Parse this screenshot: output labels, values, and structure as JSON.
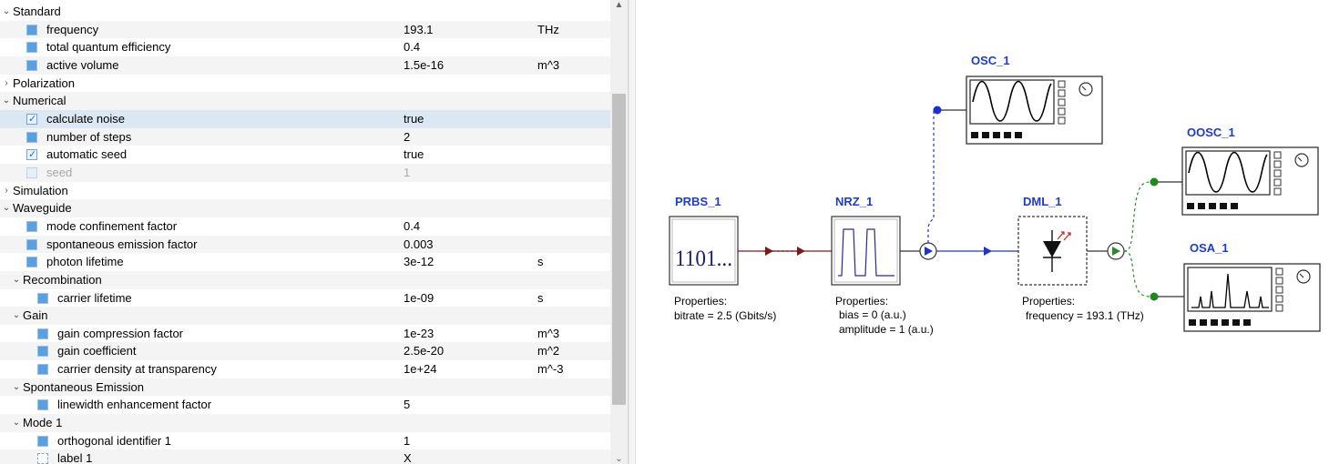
{
  "properties": {
    "rows": [
      {
        "kind": "group",
        "indent": 0,
        "expanded": true,
        "name": "Standard"
      },
      {
        "kind": "prop",
        "indent": 1,
        "check": "blue",
        "name": "frequency",
        "value": "193.1",
        "unit": "THz"
      },
      {
        "kind": "prop",
        "indent": 1,
        "check": "blue",
        "name": "total quantum efficiency",
        "value": "0.4",
        "unit": ""
      },
      {
        "kind": "prop",
        "indent": 1,
        "check": "blue",
        "name": "active volume",
        "value": "1.5e-16",
        "unit": "m^3"
      },
      {
        "kind": "group",
        "indent": 0,
        "expanded": false,
        "name": "Polarization"
      },
      {
        "kind": "group",
        "indent": 0,
        "expanded": true,
        "name": "Numerical"
      },
      {
        "kind": "prop",
        "indent": 1,
        "check": "on",
        "name": "calculate noise",
        "value": "true",
        "unit": "",
        "selected": true
      },
      {
        "kind": "prop",
        "indent": 1,
        "check": "blue",
        "name": "number of steps",
        "value": "2",
        "unit": ""
      },
      {
        "kind": "prop",
        "indent": 1,
        "check": "on",
        "name": "automatic seed",
        "value": "true",
        "unit": ""
      },
      {
        "kind": "prop",
        "indent": 1,
        "check": "off",
        "name": "seed",
        "value": "1",
        "unit": "",
        "disabled": true
      },
      {
        "kind": "group",
        "indent": 0,
        "expanded": false,
        "name": "Simulation"
      },
      {
        "kind": "group",
        "indent": 0,
        "expanded": true,
        "name": "Waveguide"
      },
      {
        "kind": "prop",
        "indent": 1,
        "check": "blue",
        "name": "mode confinement factor",
        "value": "0.4",
        "unit": ""
      },
      {
        "kind": "prop",
        "indent": 1,
        "check": "blue",
        "name": "spontaneous emission factor",
        "value": "0.003",
        "unit": ""
      },
      {
        "kind": "prop",
        "indent": 1,
        "check": "blue",
        "name": "photon lifetime",
        "value": "3e-12",
        "unit": "s"
      },
      {
        "kind": "group",
        "indent": 1,
        "expanded": true,
        "name": "Recombination"
      },
      {
        "kind": "prop",
        "indent": 2,
        "check": "blue",
        "name": "carrier lifetime",
        "value": "1e-09",
        "unit": "s"
      },
      {
        "kind": "group",
        "indent": 1,
        "expanded": true,
        "name": "Gain"
      },
      {
        "kind": "prop",
        "indent": 2,
        "check": "blue",
        "name": "gain compression factor",
        "value": "1e-23",
        "unit": "m^3"
      },
      {
        "kind": "prop",
        "indent": 2,
        "check": "blue",
        "name": "gain coefficient",
        "value": "2.5e-20",
        "unit": "m^2"
      },
      {
        "kind": "prop",
        "indent": 2,
        "check": "blue",
        "name": "carrier density at transparency",
        "value": "1e+24",
        "unit": "m^-3"
      },
      {
        "kind": "group",
        "indent": 1,
        "expanded": true,
        "name": "Spontaneous Emission"
      },
      {
        "kind": "prop",
        "indent": 2,
        "check": "blue",
        "name": "linewidth enhancement factor",
        "value": "5",
        "unit": ""
      },
      {
        "kind": "group",
        "indent": 1,
        "expanded": true,
        "name": "Mode 1"
      },
      {
        "kind": "prop",
        "indent": 2,
        "check": "blue",
        "name": "orthogonal identifier 1",
        "value": "1",
        "unit": ""
      },
      {
        "kind": "prop",
        "indent": 2,
        "check": "txt",
        "name": "label 1",
        "value": "X",
        "unit": ""
      }
    ]
  },
  "schematic": {
    "prbs": {
      "label": "PRBS_1",
      "display": "1101...",
      "props": [
        "Properties:",
        "bitrate = 2.5 (Gbits/s)"
      ]
    },
    "nrz": {
      "label": "NRZ_1",
      "props": [
        "Properties:",
        "bias = 0 (a.u.)",
        "amplitude = 1 (a.u.)"
      ]
    },
    "dml": {
      "label": "DML_1",
      "props": [
        "Properties:",
        "frequency = 193.1 (THz)"
      ]
    },
    "osc": {
      "label": "OSC_1"
    },
    "oosc": {
      "label": "OOSC_1"
    },
    "osa": {
      "label": "OSA_1"
    },
    "colors": {
      "label": "#1e3cc8",
      "electrical": "#7a1a1a",
      "optical_dashed": "#2a8a2a",
      "signal_blue": "#2233cc"
    }
  }
}
